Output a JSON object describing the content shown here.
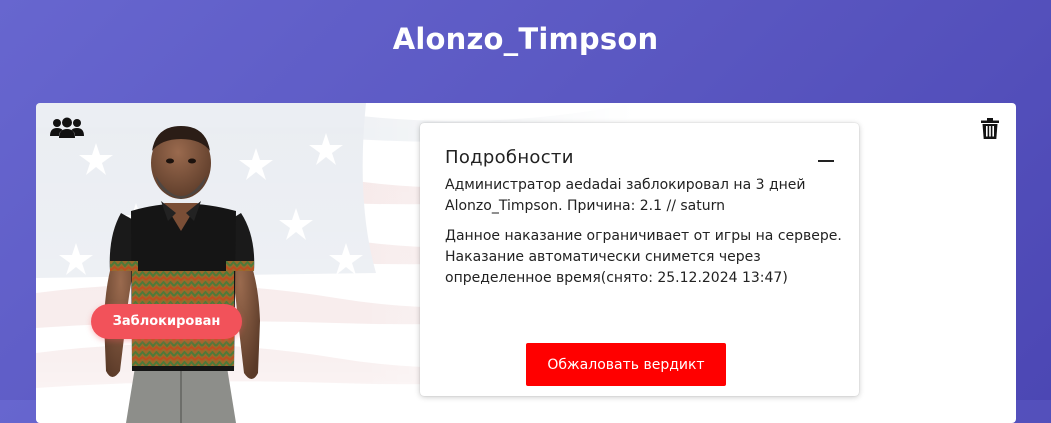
{
  "page": {
    "title": "Alonzo_Timpson"
  },
  "card": {
    "status_badge": "Заблокирован",
    "icons": {
      "left": "users-group-icon",
      "right": "trash-icon"
    }
  },
  "details": {
    "title": "Подробности",
    "collapse_icon": "minus-icon",
    "line1": "Администратор aedadai заблокировал на 3 дней Alonzo_Timpson. Причина: 2.1 // saturn",
    "line2": "Данное наказание ограничивает от игры на сервере. Наказание автоматически снимется через определенное время(снято: 25.12.2024 13:47)",
    "appeal_button": "Обжаловать вердикт"
  },
  "colors": {
    "background_gradient": [
      "#6766cf",
      "#4c47b4"
    ],
    "badge": "#f2525a",
    "appeal_button": "#ff0000"
  }
}
